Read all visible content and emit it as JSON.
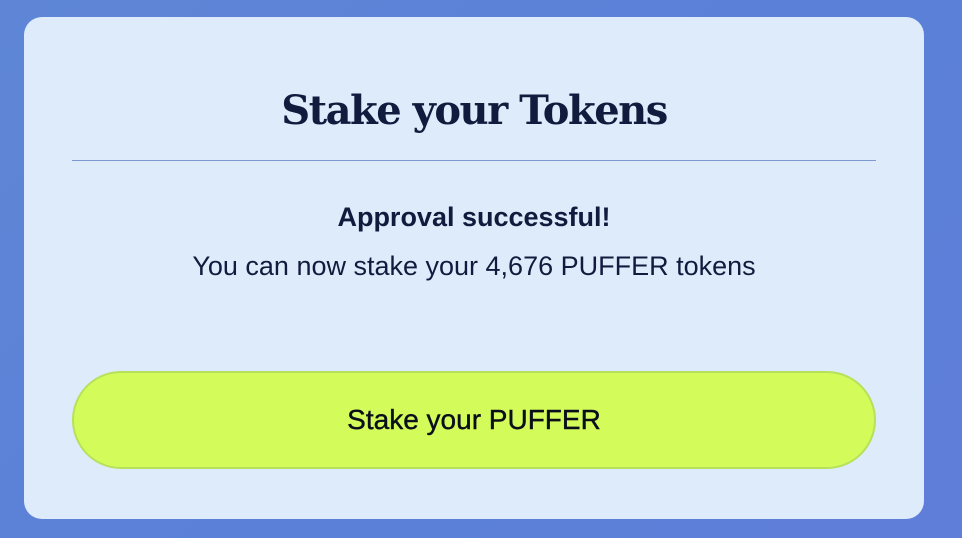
{
  "modal": {
    "title": "Stake your Tokens",
    "status_heading": "Approval successful!",
    "status_message": "You can now stake your 4,676 PUFFER tokens",
    "stake_button_label": "Stake your PUFFER"
  },
  "colors": {
    "background": "#5a80d8",
    "card": "#deebfb",
    "text": "#111b3d",
    "button": "#d3fc5a"
  }
}
